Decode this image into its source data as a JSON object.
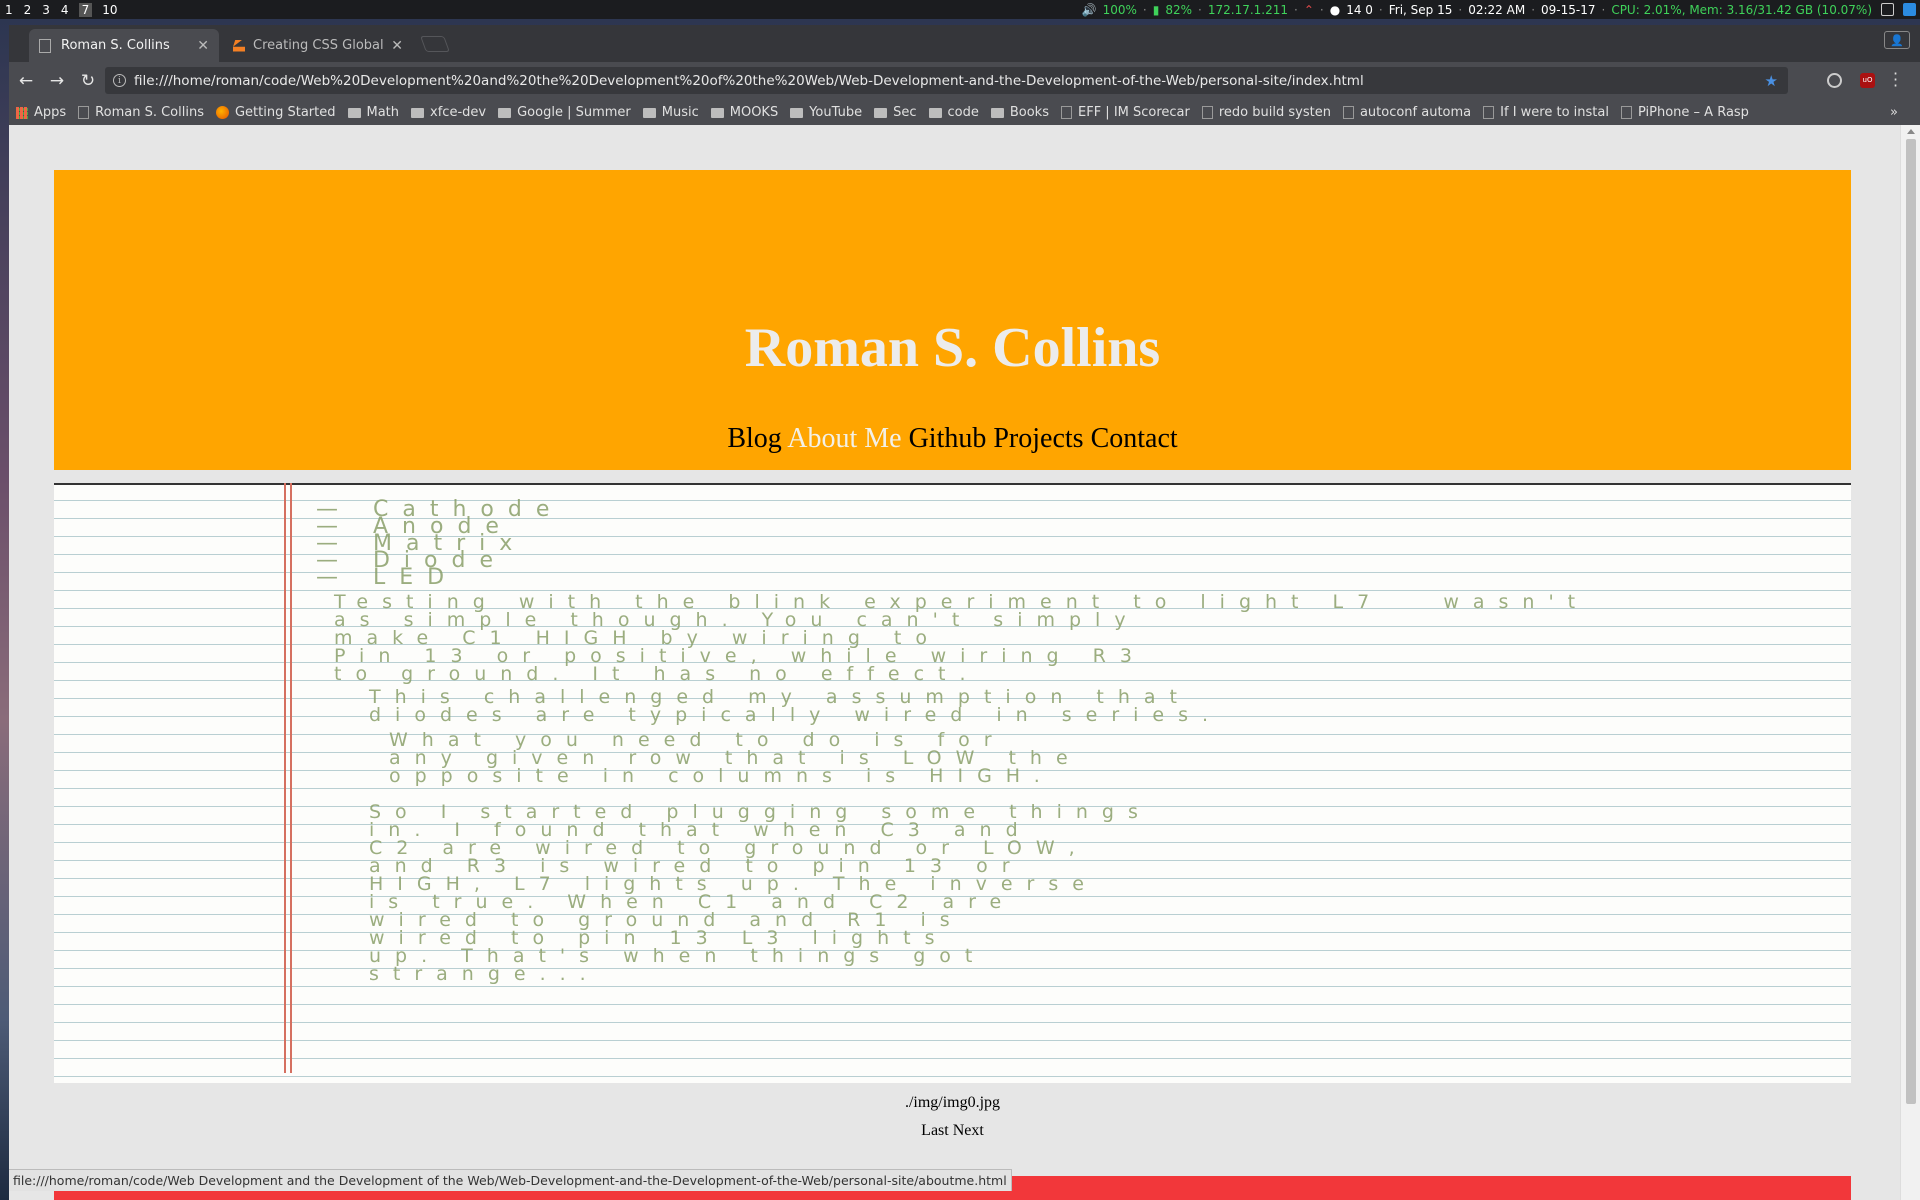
{
  "panel": {
    "workspaces": [
      "1",
      "2",
      "3",
      "4",
      "7",
      "10"
    ],
    "active_workspace": "7",
    "volume": "100%",
    "battery": "82%",
    "ip": "172.17.1.211",
    "net_counts": "14 0",
    "date": "Fri, Sep 15",
    "time": "02:22 AM",
    "date_short": "09-15-17",
    "sysinfo": "CPU: 2.01%, Mem: 3.16/31.42 GB (10.07%)"
  },
  "browser": {
    "tabs": [
      {
        "title": "Roman S. Collins"
      },
      {
        "title": "Creating CSS Global"
      }
    ],
    "url": "file:///home/roman/code/Web%20Development%20and%20the%20Development%20of%20the%20Web/Web-Development-and-the-Development-of-the-Web/personal-site/index.html",
    "bookmarks": [
      {
        "label": "Apps",
        "icon": "apps-icon"
      },
      {
        "label": "Roman S. Collins",
        "icon": "page-icon"
      },
      {
        "label": "Getting Started",
        "icon": "firefox-icon"
      },
      {
        "label": "Math",
        "icon": "folder-icon"
      },
      {
        "label": "xfce-dev",
        "icon": "folder-icon"
      },
      {
        "label": "Google | Summer",
        "icon": "folder-icon"
      },
      {
        "label": "Music",
        "icon": "folder-icon"
      },
      {
        "label": "MOOKS",
        "icon": "folder-icon"
      },
      {
        "label": "YouTube",
        "icon": "folder-icon"
      },
      {
        "label": "Sec",
        "icon": "folder-icon"
      },
      {
        "label": "code",
        "icon": "folder-icon"
      },
      {
        "label": "Books",
        "icon": "folder-icon"
      },
      {
        "label": "EFF | IM Scorecar",
        "icon": "page-icon"
      },
      {
        "label": "redo build systen",
        "icon": "page-icon"
      },
      {
        "label": "autoconf automa",
        "icon": "page-icon"
      },
      {
        "label": "If I were to instal",
        "icon": "page-icon"
      },
      {
        "label": "PiPhone – A Rasp",
        "icon": "page-icon"
      }
    ],
    "bookmarks_overflow": "»",
    "status_url": "file:///home/roman/code/Web Development and the Development of the Web/Web-Development-and-the-Development-of-the-Web/personal-site/aboutme.html"
  },
  "site": {
    "title": "Roman S. Collins",
    "nav": [
      "Blog",
      "About Me",
      "Github Projects",
      "Contact"
    ],
    "current_nav": "About Me",
    "colors": {
      "header": "#ffa500",
      "footer": "#f2373a"
    },
    "gallery": {
      "caption": "./img/img0.jpg",
      "prev": "Last",
      "next": "Next"
    }
  }
}
